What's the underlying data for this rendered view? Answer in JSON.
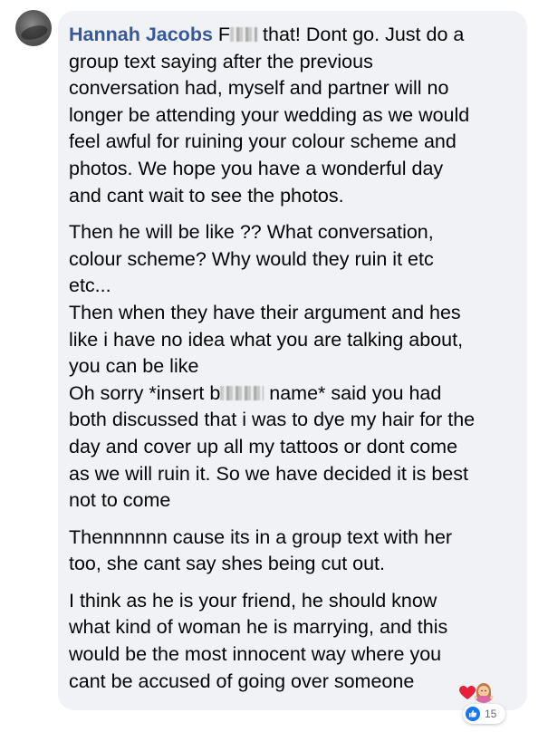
{
  "comment": {
    "author": "Hannah Jacobs",
    "paragraphs": [
      [
        "F",
        "that! Dont go. Just do a",
        "group text saying after the previous",
        "conversation had, myself and partner will no",
        "longer be attending your wedding as we would",
        "feel awful for ruining your colour scheme and",
        "photos. We hope you have a wonderful day",
        "and cant wait to see the photos."
      ],
      [
        "Then he will be like ?? What conversation,",
        "colour scheme? Why would they ruin it etc",
        "etc...",
        "Then when they have their argument and hes",
        "like i have no idea what you are talking about,",
        "you can be like",
        "Oh sorry *insert b",
        "name* said you had",
        "both discussed that i was to dye my hair for the",
        "day and cover up all my tattoos or dont come",
        "as we will ruin it. So we have decided it is best",
        "not to come"
      ],
      [
        "Thennnnnn cause its in a group text with her",
        "too, she cant say shes being cut out."
      ],
      [
        "I think as he is your friend, he should know",
        "what kind of woman he is marrying, and this",
        "would be the most innocent way where you",
        "cant be accused of going over someone"
      ]
    ],
    "emojis": [
      "heart-emoji",
      "shrugging-woman-emoji"
    ],
    "reactions": {
      "icon": "like-icon",
      "count": "15",
      "color": "#1877f2"
    }
  },
  "colors": {
    "author": "#385898",
    "bubble": "#f0f2f5",
    "text": "#050505"
  }
}
